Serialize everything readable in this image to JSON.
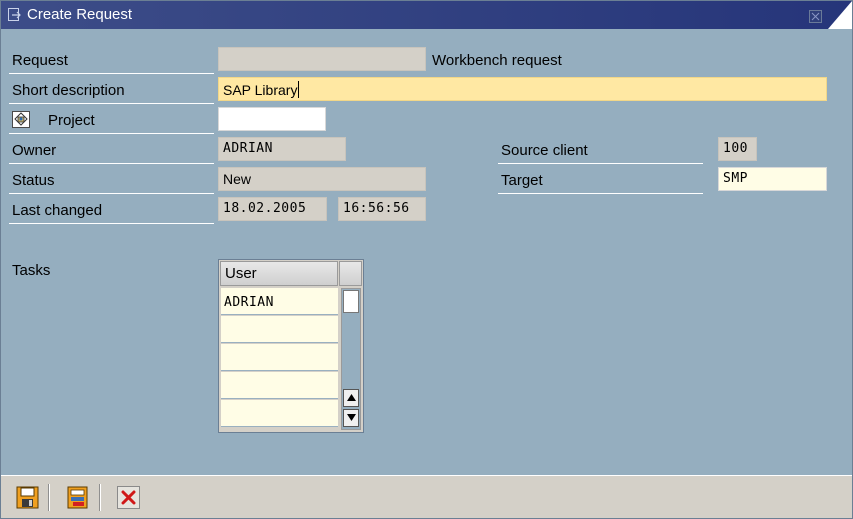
{
  "window": {
    "title": "Create Request",
    "title_icon": "create-request-icon",
    "close_icon": "close-icon"
  },
  "form": {
    "request": {
      "label": "Request",
      "value": "",
      "type_text": "Workbench request"
    },
    "short_description": {
      "label": "Short description",
      "value": "SAP Library"
    },
    "project": {
      "label": "Project",
      "icon": "project-icon",
      "value": ""
    },
    "owner": {
      "label": "Owner",
      "value": "ADRIAN"
    },
    "status": {
      "label": "Status",
      "value": "New"
    },
    "last_changed": {
      "label": "Last changed",
      "date": "18.02.2005",
      "time": "16:56:56"
    },
    "source_client": {
      "label": "Source client",
      "value": "100"
    },
    "target": {
      "label": "Target",
      "value": "SMP"
    }
  },
  "tasks": {
    "label": "Tasks",
    "column_header": "User",
    "rows": [
      "ADRIAN",
      "",
      "",
      "",
      ""
    ]
  },
  "toolbar": {
    "buttons": [
      {
        "name": "save-icon"
      },
      {
        "name": "local-request-icon"
      },
      {
        "name": "cancel-icon"
      }
    ]
  },
  "colors": {
    "title_bar": "#2e3e7c",
    "background": "#95aebf",
    "active_field": "#ffe8a3",
    "readonly_field": "#d4d0c8",
    "toolbar": "#d4d0c8"
  }
}
